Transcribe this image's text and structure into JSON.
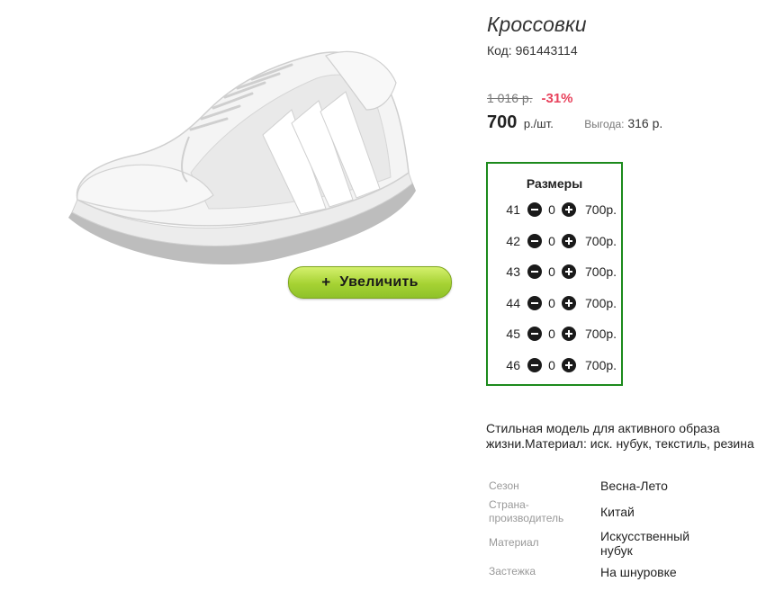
{
  "product": {
    "title": "Кроссовки",
    "code_label": "Код:",
    "code": "961443114"
  },
  "pricing": {
    "old_price": "1 016 р.",
    "discount": "-31%",
    "price": "700",
    "price_unit": "р./шт.",
    "savings_label": "Выгода:",
    "savings_value": "316 р."
  },
  "image": {
    "zoom_plus": "+",
    "zoom_label": "Увеличить"
  },
  "sizes": {
    "title": "Размеры",
    "items": [
      {
        "size": "41",
        "qty": "0",
        "price": "700р."
      },
      {
        "size": "42",
        "qty": "0",
        "price": "700р."
      },
      {
        "size": "43",
        "qty": "0",
        "price": "700р."
      },
      {
        "size": "44",
        "qty": "0",
        "price": "700р."
      },
      {
        "size": "45",
        "qty": "0",
        "price": "700р."
      },
      {
        "size": "46",
        "qty": "0",
        "price": "700р."
      }
    ]
  },
  "description": "Стильная модель для активного образа жизни.Материал: иск. нубук, текстиль, резина",
  "attributes": [
    {
      "label": "Сезон",
      "value": "Весна-Лето"
    },
    {
      "label": "Страна-производитель",
      "value": "Китай"
    },
    {
      "label": "Материал",
      "value": "Искусственный нубук"
    },
    {
      "label": "Застежка",
      "value": "На шнуровке"
    }
  ],
  "colors": {
    "accent_green": "#1c8a1c",
    "discount_red": "#e8425c",
    "zoom_button": "#a6d233"
  },
  "icons": {
    "minus": "minus-circle-icon",
    "plus": "plus-circle-icon"
  }
}
